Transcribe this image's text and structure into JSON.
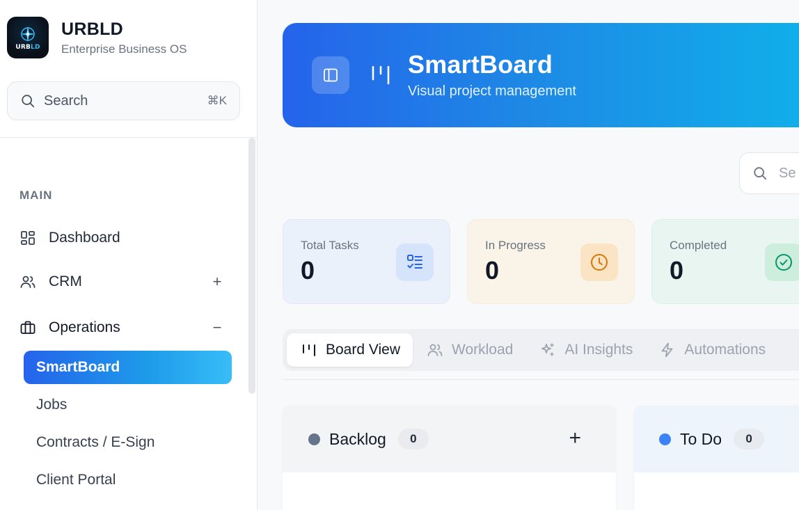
{
  "brand": {
    "name": "URBLD",
    "tagline": "Enterprise Business OS",
    "logo_text": "URBLD"
  },
  "sidebar_search": {
    "placeholder": "Search",
    "shortcut": "⌘K"
  },
  "sidebar": {
    "section_label": "MAIN",
    "items": [
      {
        "label": "Dashboard",
        "icon": "grid-icon"
      },
      {
        "label": "CRM",
        "icon": "users-icon",
        "toggle": "+"
      },
      {
        "label": "Operations",
        "icon": "briefcase-icon",
        "toggle": "−"
      }
    ],
    "sub_items": [
      {
        "label": "SmartBoard",
        "active": true
      },
      {
        "label": "Jobs"
      },
      {
        "label": "Contracts / E-Sign"
      },
      {
        "label": "Client Portal"
      }
    ]
  },
  "header": {
    "title": "SmartBoard",
    "subtitle": "Visual project management"
  },
  "board_search": {
    "placeholder": "Se"
  },
  "stats": [
    {
      "label": "Total Tasks",
      "value": "0",
      "icon": "checklist-icon",
      "color": "#2563eb"
    },
    {
      "label": "In Progress",
      "value": "0",
      "icon": "clock-icon",
      "color": "#d97706"
    },
    {
      "label": "Completed",
      "value": "0",
      "icon": "check-circle-icon",
      "color": "#059669"
    }
  ],
  "tabs": [
    {
      "label": "Board View",
      "icon": "board-icon",
      "active": true
    },
    {
      "label": "Workload",
      "icon": "users-icon"
    },
    {
      "label": "AI Insights",
      "icon": "sparkles-icon"
    },
    {
      "label": "Automations",
      "icon": "bolt-icon"
    }
  ],
  "columns": [
    {
      "title": "Backlog",
      "count": "0",
      "dot_color": "#64748b",
      "add": "+"
    },
    {
      "title": "To Do",
      "count": "0",
      "dot_color": "#3b82f6"
    }
  ]
}
